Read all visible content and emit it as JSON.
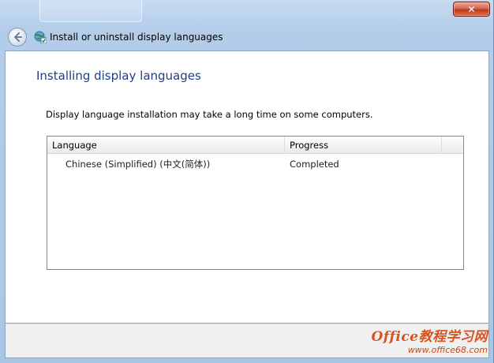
{
  "window": {
    "close_glyph": "✕"
  },
  "nav": {
    "back_icon": "back-arrow-icon",
    "location_icon": "globe-language-icon",
    "title": "Install or uninstall display languages"
  },
  "main": {
    "heading": "Installing display languages",
    "description": "Display language installation may take a long time on some computers.",
    "table": {
      "columns": [
        "Language",
        "Progress"
      ],
      "rows": [
        {
          "language": "Chinese (Simplified) (中文(简体))",
          "progress": "Completed"
        }
      ]
    }
  },
  "watermark": {
    "line1": "Office教程学习网",
    "line2": "www.office68.com"
  },
  "colors": {
    "heading": "#1e3f82",
    "close_button": "#c0391d",
    "watermark": "#d9531e"
  }
}
